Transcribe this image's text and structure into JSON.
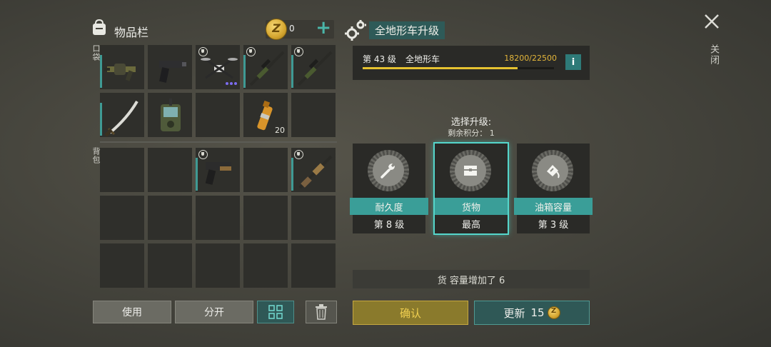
{
  "inventory": {
    "title": "物品栏",
    "coins": "0",
    "pocket_label": "口袋",
    "backpack_label": "背包",
    "pocket_slots": [
      {
        "icon": "grenade-launcher-icon",
        "count": "",
        "durability": true,
        "shield": false
      },
      {
        "icon": "pistol-icon",
        "count": "",
        "durability": false,
        "shield": false
      },
      {
        "icon": "drone-icon",
        "count": "",
        "durability": false,
        "shield": true
      },
      {
        "icon": "sniper-rifle-icon",
        "count": "",
        "durability": true,
        "shield": true
      },
      {
        "icon": "sniper-rifle-icon",
        "count": "",
        "durability": true,
        "shield": true
      },
      {
        "icon": "katana-icon",
        "count": "",
        "durability": true,
        "shield": false
      },
      {
        "icon": "tracker-device-icon",
        "count": "",
        "durability": false,
        "shield": false
      },
      {
        "icon": "empty",
        "count": "",
        "durability": false,
        "shield": false
      },
      {
        "icon": "cartridge-ammo-icon",
        "count": "20",
        "durability": false,
        "shield": false
      },
      {
        "icon": "empty",
        "count": "",
        "durability": false,
        "shield": false
      }
    ],
    "backpack_slots": [
      {
        "icon": "empty",
        "count": "",
        "durability": false,
        "shield": false
      },
      {
        "icon": "empty",
        "count": "",
        "durability": false,
        "shield": false
      },
      {
        "icon": "desert-pistol-icon",
        "count": "",
        "durability": true,
        "shield": true
      },
      {
        "icon": "empty",
        "count": "",
        "durability": false,
        "shield": false
      },
      {
        "icon": "shotgun-icon",
        "count": "",
        "durability": true,
        "shield": true
      },
      {
        "icon": "empty",
        "count": "",
        "durability": false,
        "shield": false
      },
      {
        "icon": "empty",
        "count": "",
        "durability": false,
        "shield": false
      },
      {
        "icon": "empty",
        "count": "",
        "durability": false,
        "shield": false
      },
      {
        "icon": "empty",
        "count": "",
        "durability": false,
        "shield": false
      },
      {
        "icon": "empty",
        "count": "",
        "durability": false,
        "shield": false
      },
      {
        "icon": "empty",
        "count": "",
        "durability": false,
        "shield": false
      },
      {
        "icon": "empty",
        "count": "",
        "durability": false,
        "shield": false
      },
      {
        "icon": "empty",
        "count": "",
        "durability": false,
        "shield": false
      },
      {
        "icon": "empty",
        "count": "",
        "durability": false,
        "shield": false
      },
      {
        "icon": "empty",
        "count": "",
        "durability": false,
        "shield": false
      }
    ],
    "buttons": {
      "use": "使用",
      "split": "分开"
    }
  },
  "upgrade": {
    "title": "全地形车升级",
    "level_label": "第 43 级",
    "vehicle": "全地形车",
    "xp": "18200/22500",
    "xp_fraction": 0.809,
    "info": "i",
    "choose": "选择升级:",
    "points": "剩余积分： 1",
    "options": [
      {
        "name": "耐久度",
        "level": "第 8 级",
        "icon": "wrench-icon",
        "selected": false
      },
      {
        "name": "货物",
        "level": "最高",
        "icon": "cargo-box-icon",
        "selected": true
      },
      {
        "name": "油箱容量",
        "level": "第 3 级",
        "icon": "fuel-can-icon",
        "selected": false
      }
    ],
    "effect": "货 容量增加了 6",
    "confirm": "确认",
    "refresh": "更新",
    "refresh_cost": "15"
  },
  "close": {
    "label": "关闭"
  },
  "colors": {
    "accent": "#3a9e98",
    "gold": "#e6c230"
  }
}
